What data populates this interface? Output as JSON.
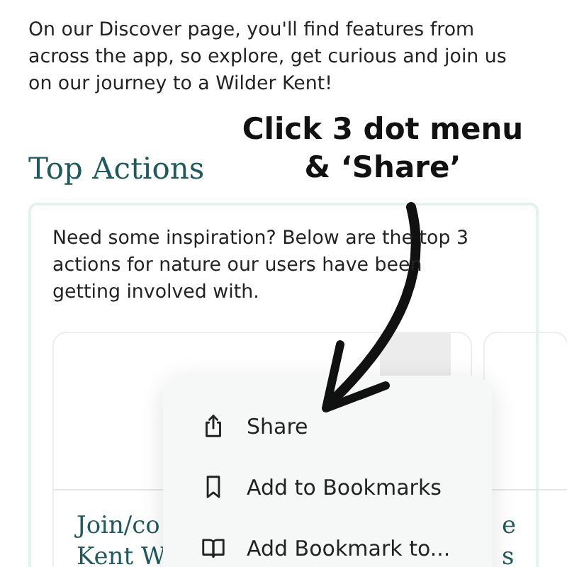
{
  "intro": "On our Discover page, you'll find features from across the app, so explore, get curious and join us on our journey to a Wilder Kent!",
  "section_title": "Top Actions",
  "card": {
    "description": "Need some inspiration? Below are the top 3 actions for nature our users have been getting involved with.",
    "actions": [
      {
        "title_lines": [
          "Join/co",
          "Kent W"
        ]
      },
      {
        "title_lines": [
          "e",
          "s"
        ]
      }
    ]
  },
  "annotation": {
    "lines": [
      "Click 3 dot menu",
      "& ‘Share’"
    ]
  },
  "context_menu": [
    {
      "kind": "share",
      "label": "Share"
    },
    {
      "kind": "bookmark",
      "label": "Add to Bookmarks"
    },
    {
      "kind": "book",
      "label": "Add Bookmark to..."
    }
  ]
}
